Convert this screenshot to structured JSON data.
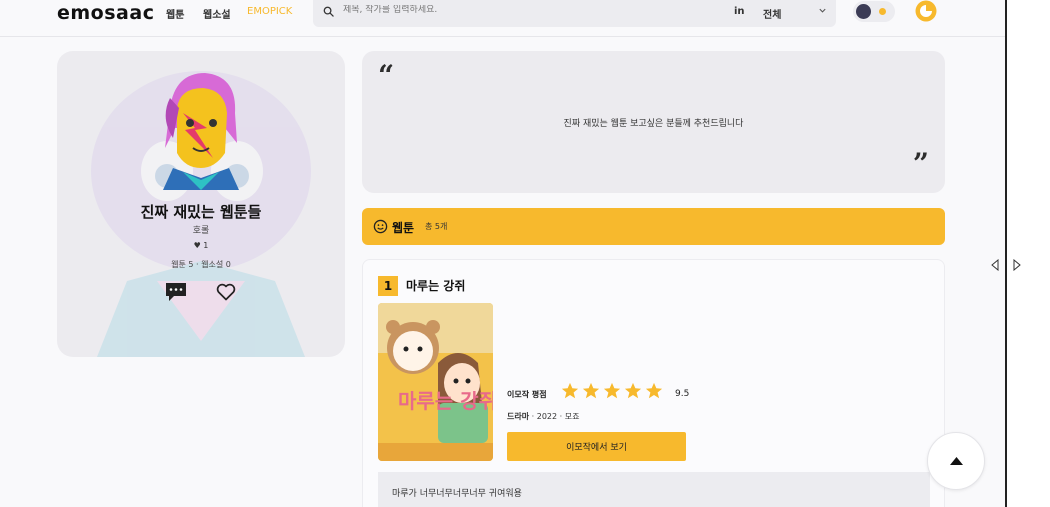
{
  "header": {
    "logo": "emosaac",
    "nav": [
      "웹툰",
      "웹소설",
      "EMOPICK"
    ],
    "search_placeholder": "제목, 작가를 입력하세요.",
    "search_scope_in": "in",
    "search_scope": "전체"
  },
  "profile": {
    "title": "진짜 재밌는 웹툰들",
    "author": "호롤",
    "likes": "♥ 1",
    "counts": "웹툰 5 · 웹소설 0"
  },
  "quote": {
    "open_mark": "“",
    "close_mark": "”",
    "text": "진짜 재밌는 웹툰 보고싶은 분들께 추천드립니다"
  },
  "section": {
    "title": "웹툰",
    "count": "총 5개"
  },
  "item": {
    "rank": "1",
    "title": "마루는 강쥐",
    "rating_label": "이모작 평점",
    "rating_value": "9.5",
    "rating_stars": 5,
    "genre": "드라마",
    "year": "2022",
    "author": "모죠",
    "view_button": "이모작에서 보기",
    "description": "마루가 너무너무너무너무 귀여워용",
    "cover_title": "마루는 강쥐"
  },
  "colors": {
    "accent": "#f7b92d",
    "card_bg": "#ecebef",
    "page_bg": "#f9f9fb"
  }
}
